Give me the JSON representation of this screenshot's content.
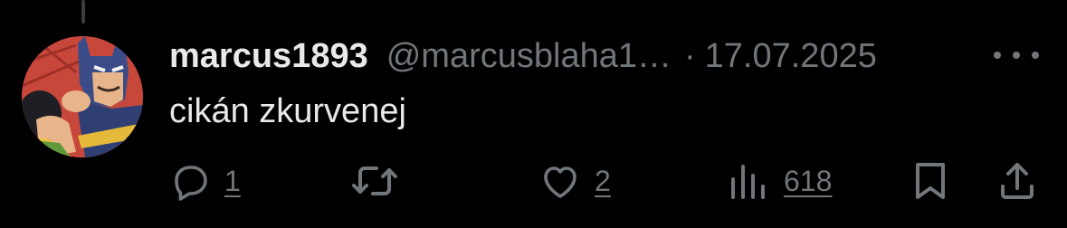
{
  "colors": {
    "background": "#000000",
    "primary_text": "#e7e9ea",
    "secondary_text": "#71767b",
    "thread_line": "#3a3d40"
  },
  "post": {
    "avatar_icon": "batman-slap-comic-avatar",
    "display_name": "marcus1893",
    "handle": "@marcusblaha1…",
    "separator": "·",
    "date": "17.07.2025",
    "more_icon": "ellipsis-icon",
    "text": "cikán zkurvenej"
  },
  "actions": {
    "reply": {
      "icon": "reply-bubble-icon",
      "count": "1"
    },
    "retweet": {
      "icon": "retweet-icon",
      "count": ""
    },
    "like": {
      "icon": "heart-icon",
      "count": "2"
    },
    "views": {
      "icon": "views-bar-chart-icon",
      "count": "618"
    },
    "bookmark": {
      "icon": "bookmark-icon"
    },
    "share": {
      "icon": "share-upload-icon"
    }
  }
}
